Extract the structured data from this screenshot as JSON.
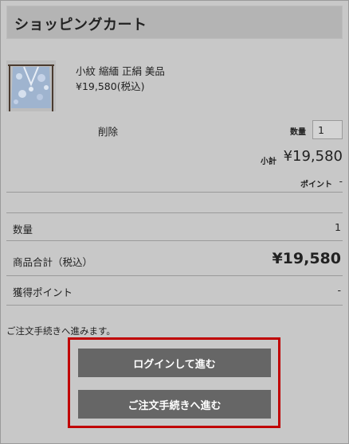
{
  "header": {
    "title": "ショッピングカート"
  },
  "item": {
    "image_icon": "kimono-thumbnail",
    "name": "小紋 縮緬 正絹 美品",
    "price": "¥19,580(税込)",
    "delete_label": "削除",
    "qty_label": "数量",
    "qty_value": "1",
    "subtotal_label": "小計",
    "subtotal_value": "¥19,580",
    "points_label": "ポイント",
    "points_value": "-"
  },
  "summary": {
    "rows": [
      {
        "label": "数量",
        "value": "1"
      },
      {
        "label": "商品合計（税込）",
        "value": "¥19,580"
      },
      {
        "label": "獲得ポイント",
        "value": "-"
      }
    ]
  },
  "checkout": {
    "note": "ご注文手続きへ進みます。",
    "login_button": "ログインして進む",
    "order_button": "ご注文手続きへ進む"
  },
  "colors": {
    "background": "#c8c8c8",
    "button": "#666666",
    "highlight_border": "#c00000"
  }
}
